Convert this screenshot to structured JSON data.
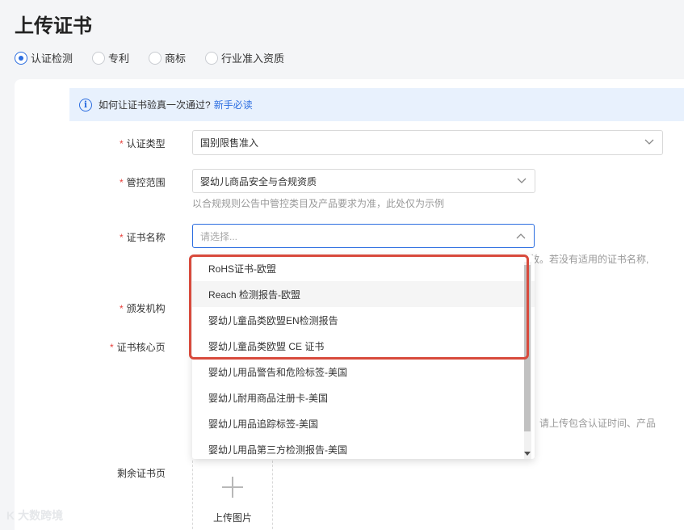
{
  "page": {
    "title": "上传证书"
  },
  "tabs": [
    {
      "label": "认证检测",
      "checked": true
    },
    {
      "label": "专利",
      "checked": false
    },
    {
      "label": "商标",
      "checked": false
    },
    {
      "label": "行业准入资质",
      "checked": false
    }
  ],
  "notice": {
    "icon": "info-icon",
    "text": "如何让证书验真一次通过?",
    "link": "新手必读"
  },
  "form": {
    "cert_type": {
      "label": "认证类型",
      "value": "国别限售准入"
    },
    "control_scope": {
      "label": "管控范围",
      "value": "婴幼儿商品安全与合规资质",
      "hint": "以合规规则公告中管控类目及产品要求为准，此处仅为示例"
    },
    "cert_name": {
      "label": "证书名称",
      "placeholder": "请选择...",
      "hint_tail": "效。若没有适用的证书名称,"
    },
    "issuer": {
      "label": "颁发机构"
    },
    "core_page": {
      "label": "证书核心页",
      "hint_tail": "请上传包含认证时间、产品"
    },
    "remaining": {
      "label": "剩余证书页"
    },
    "upload": {
      "label": "上传图片"
    }
  },
  "dropdown": {
    "items": [
      "RoHS证书-欧盟",
      "Reach 检测报告-欧盟",
      "婴幼儿童品类欧盟EN检测报告",
      "婴幼儿童品类欧盟 CE 证书",
      "婴幼儿用品警告和危险标签-美国",
      "婴幼儿耐用商品注册卡-美国",
      "婴幼儿用品追踪标签-美国",
      "婴幼儿用品第三方检测报告-美国"
    ],
    "highlight_color": "#d84a3c"
  },
  "watermark": {
    "text": "大数跨境"
  },
  "colors": {
    "accent": "#2b6de0",
    "required": "#e8413c"
  }
}
